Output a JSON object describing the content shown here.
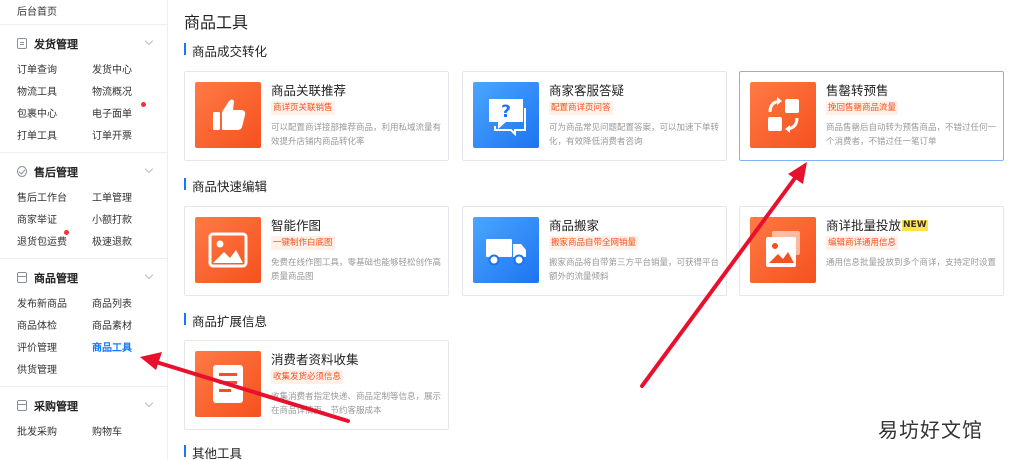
{
  "sidebar": {
    "top_item": "后台首页",
    "groups": [
      {
        "title": "发货管理",
        "icon": "document-icon",
        "items": [
          "订单查询",
          "发货中心",
          "物流工具",
          "物流概况",
          "包裹中心",
          "电子面单",
          "打单工具",
          "订单开票"
        ]
      },
      {
        "title": "售后管理",
        "icon": "check-circle-icon",
        "items": [
          "售后工作台",
          "工单管理",
          "商家举证",
          "小额打款",
          "退货包运费",
          "极速退款"
        ]
      },
      {
        "title": "商品管理",
        "icon": "box-icon",
        "items": [
          "发布新商品",
          "商品列表",
          "商品体检",
          "商品素材",
          "评价管理",
          "商品工具",
          "供货管理"
        ]
      },
      {
        "title": "采购管理",
        "icon": "cart-icon",
        "items": [
          "批发采购",
          "购物车"
        ]
      }
    ]
  },
  "main": {
    "page_title": "商品工具",
    "sections": [
      {
        "title": "商品成交转化",
        "cards": [
          {
            "title": "商品关联推荐",
            "tag": "商详页关联销售",
            "desc": "可以配置商详接部推荐商品，利用私域流量有效提升店铺内商品转化率",
            "icon": "thumbs-up-icon"
          },
          {
            "title": "商家客服答疑",
            "tag": "配置商详页问答",
            "desc": "可为商品常见问题配置答案，可以加速下单转化，有效降低消费者咨询",
            "icon": "question-chat-icon"
          },
          {
            "title": "售罄转预售",
            "tag": "挽回售罄商品流量",
            "desc": "商品售罄后自动转为预售商品，不错过任何一个消费者，不错过任一笔订单",
            "icon": "convert-icon"
          }
        ]
      },
      {
        "title": "商品快速编辑",
        "cards": [
          {
            "title": "智能作图",
            "tag": "一键制作白底图",
            "desc": "免费在线作图工具，零基础也能够轻松创作高质量商品图",
            "icon": "image-icon"
          },
          {
            "title": "商品搬家",
            "tag": "搬家商品自带全网销量",
            "desc": "搬家商品将自带第三方平台销量，可获得平台额外的流量倾斜",
            "icon": "truck-icon"
          },
          {
            "title": "商详批量投放",
            "badge": "NEW",
            "tag": "编辑商详通用信息",
            "desc": "通用信息批量投放到多个商详，支持定时设置",
            "icon": "stack-image-icon"
          }
        ]
      },
      {
        "title": "商品扩展信息",
        "cards": [
          {
            "title": "消费者资料收集",
            "tag": "收集发货必须信息",
            "desc": "收集消费者指定快递、商品定制等信息，展示在商品详情页，节约客服成本",
            "icon": "form-icon"
          }
        ]
      },
      {
        "title": "其他工具",
        "cards": []
      }
    ]
  },
  "watermark": "易坊好文馆",
  "colors": {
    "accent": "#1677ff",
    "orange": "#f5511e",
    "arrow": "#e8112d"
  }
}
